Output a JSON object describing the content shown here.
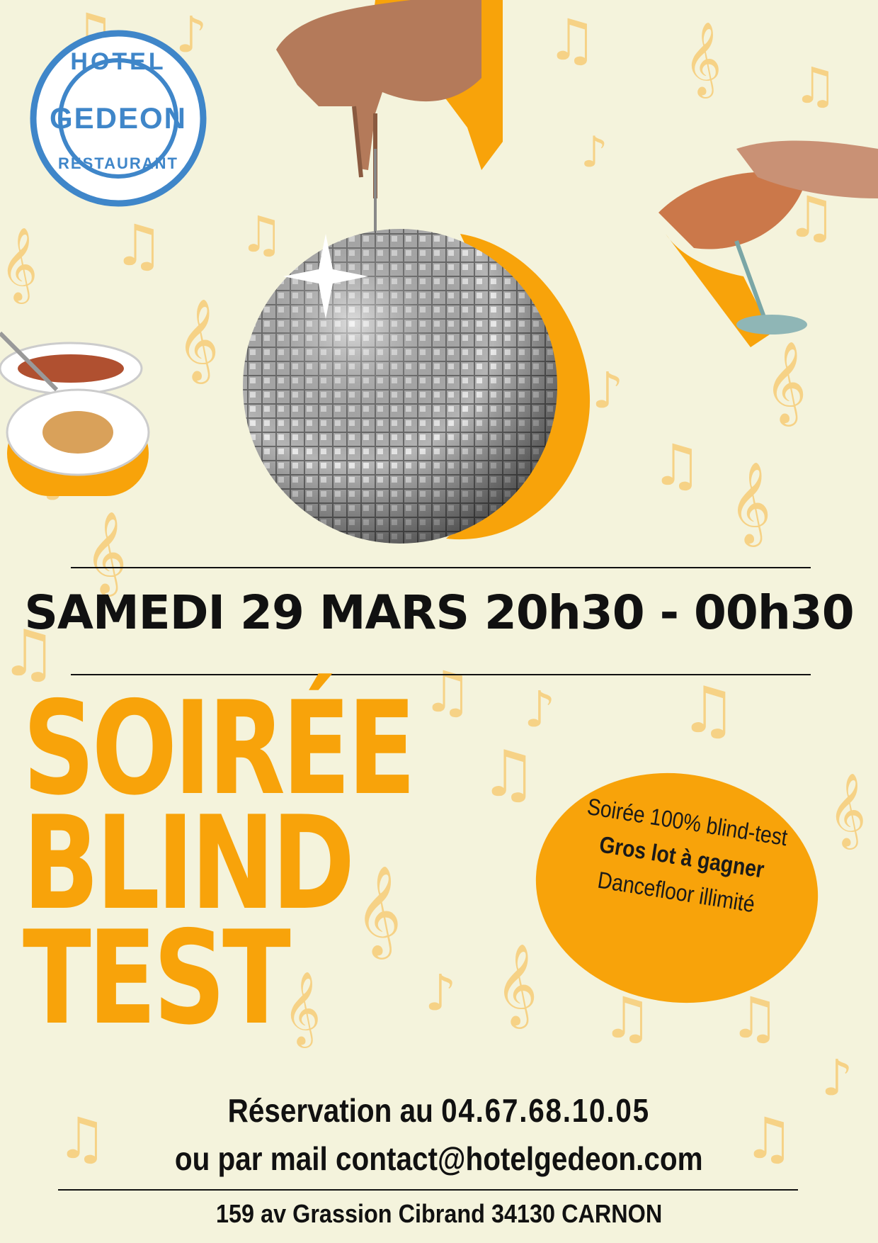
{
  "logo": {
    "top_word": "HOTEL",
    "main_word": "GEDEON",
    "bottom_word": "RESTAURANT",
    "color": "#3f86c9"
  },
  "event": {
    "date_time": "SAMEDI 29 MARS 20h30 - 00h30",
    "title_lines": [
      "SOIRÉE",
      "BLIND",
      "TEST"
    ]
  },
  "badge": {
    "line1": "Soirée 100% blind-test",
    "line2": "Gros lot à gagner",
    "line3": "Dancefloor illimité"
  },
  "contact": {
    "reservation_label": "Réservation au",
    "phone": "04.67.68.10.05",
    "mail_label": "ou par mail",
    "email": "contact@hotelgedeon.com",
    "address": "159 av Grassion Cibrand 34130 CARNON"
  },
  "colors": {
    "background": "#f4f3dc",
    "accent": "#f8a30a",
    "text": "#111111",
    "notes": "#f7c76a"
  },
  "icons": [
    "music-note-icon",
    "treble-clef-icon",
    "disco-ball-icon",
    "cocktail-glass-icon",
    "food-plate-icon"
  ]
}
